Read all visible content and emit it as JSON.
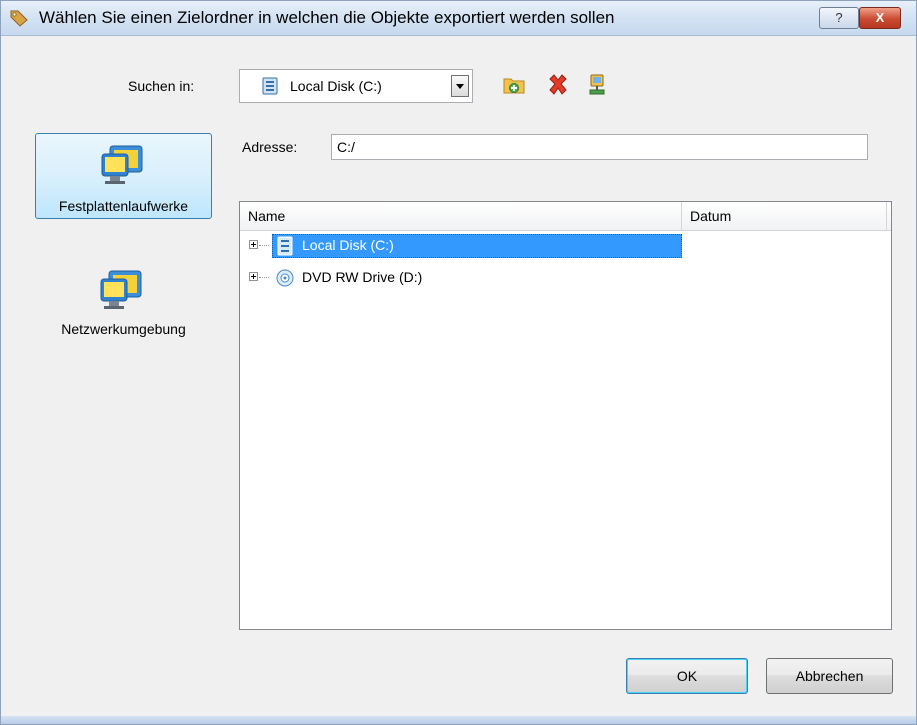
{
  "window": {
    "title": "Wählen Sie einen Zielordner in welchen die Objekte exportiert werden sollen",
    "help_label": "?",
    "close_label": "X"
  },
  "look_in": {
    "label": "Suchen in:",
    "value": "Local Disk (C:)"
  },
  "toolbar": {
    "icons": [
      "new-folder-icon",
      "delete-icon",
      "network-drive-icon"
    ]
  },
  "sidebar": {
    "items": [
      {
        "label": "Festplattenlaufwerke",
        "icon": "computer-icon",
        "selected": true
      },
      {
        "label": "Netzwerkumgebung",
        "icon": "computer-icon",
        "selected": false
      }
    ]
  },
  "address": {
    "label": "Adresse:",
    "value": "C:/"
  },
  "list": {
    "columns": [
      "Name",
      "Datum"
    ],
    "rows": [
      {
        "name": "Local Disk (C:)",
        "icon": "hard-disk-icon",
        "selected": true
      },
      {
        "name": "DVD RW Drive (D:)",
        "icon": "dvd-drive-icon",
        "selected": false
      }
    ]
  },
  "buttons": {
    "ok": "OK",
    "cancel": "Abbrechen"
  },
  "colors": {
    "selection": "#3399ff",
    "accent": "#3c7fb1"
  }
}
